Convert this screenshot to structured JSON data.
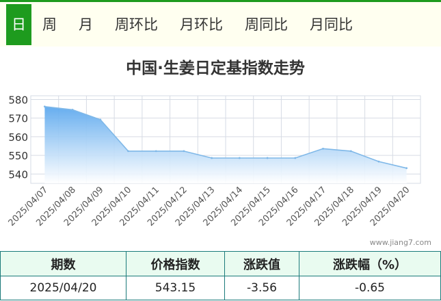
{
  "tabs": [
    {
      "label": "日",
      "active": true
    },
    {
      "label": "周",
      "active": false
    },
    {
      "label": "月",
      "active": false
    },
    {
      "label": "周环比",
      "active": false
    },
    {
      "label": "月环比",
      "active": false
    },
    {
      "label": "周同比",
      "active": false
    },
    {
      "label": "月同比",
      "active": false
    }
  ],
  "chart_data": {
    "type": "area",
    "title": "中国·生姜日定基指数走势",
    "categories": [
      "2025/04/07",
      "2025/04/08",
      "2025/04/09",
      "2025/04/10",
      "2025/04/11",
      "2025/04/12",
      "2025/04/13",
      "2025/04/14",
      "2025/04/15",
      "2025/04/16",
      "2025/04/17",
      "2025/04/18",
      "2025/04/19",
      "2025/04/20"
    ],
    "series": [
      {
        "values": [
          576.2,
          574.5,
          569.2,
          552.3,
          552.3,
          552.3,
          548.6,
          548.6,
          548.6,
          548.6,
          553.6,
          552.3,
          546.7,
          543.15
        ]
      }
    ],
    "yticks": [
      540,
      550,
      560,
      570,
      580
    ],
    "ylim": [
      535,
      582
    ],
    "grid": true,
    "legend": "none",
    "colors": {
      "line": "#7fb8e8",
      "fill_top": "#5ea9ee",
      "fill_bottom": "#ffffff",
      "grid": "#d6dbe4"
    }
  },
  "watermark": "www.jiang7.com",
  "table": {
    "headers": [
      "期数",
      "价格指数",
      "涨跌值",
      "涨跌幅（%）"
    ],
    "rows": [
      [
        "2025/04/20",
        "543.15",
        "-3.56",
        "-0.65"
      ]
    ]
  },
  "colors": {
    "accent": "#1e9b1e",
    "tab_bg": "#fffff0",
    "table_border": "#1a7a7a",
    "table_header_bg": "#e9fbf0"
  }
}
